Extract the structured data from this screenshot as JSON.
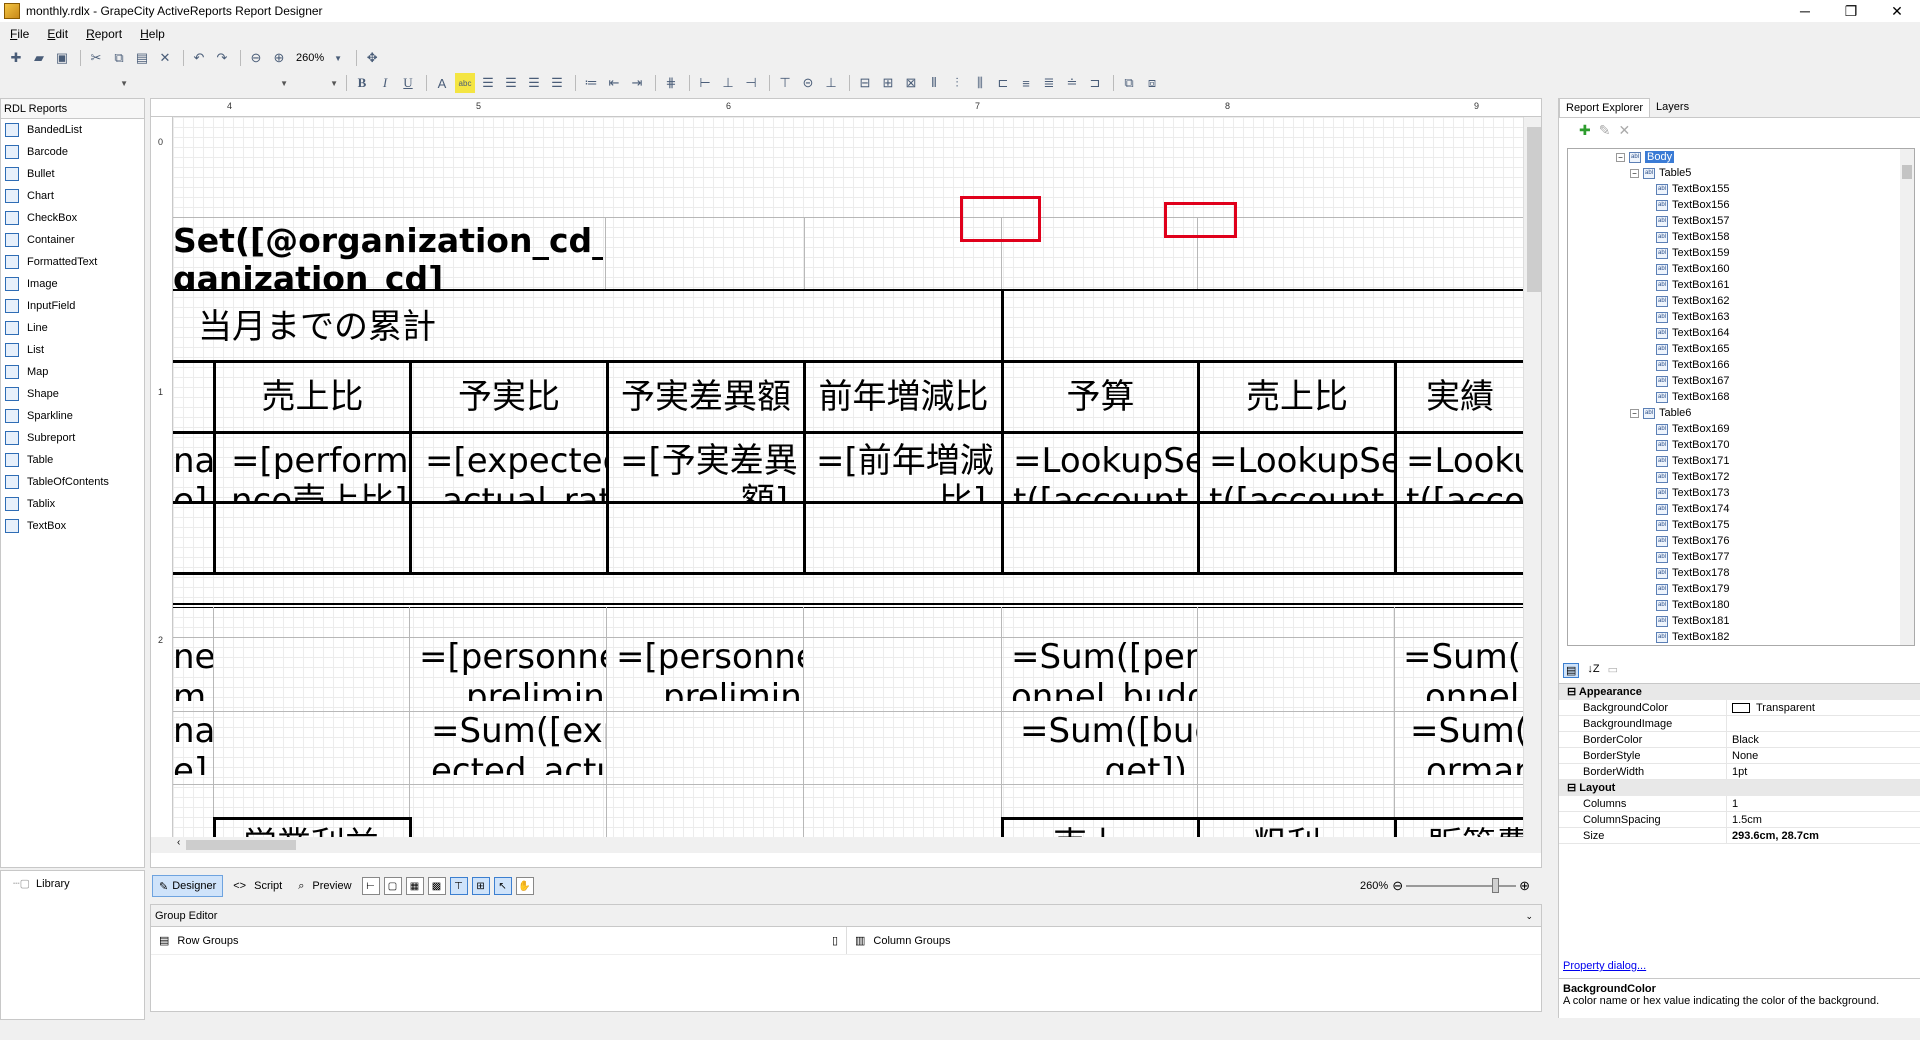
{
  "window": {
    "title": "monthly.rdlx - GrapeCity ActiveReports Report Designer",
    "min": "─",
    "max": "❐",
    "close": "✕"
  },
  "menu": [
    "File",
    "Edit",
    "Report",
    "Help"
  ],
  "toolbar": {
    "zoom": "260%"
  },
  "toolbox": {
    "header": "RDL Reports",
    "items": [
      "BandedList",
      "Barcode",
      "Bullet",
      "Chart",
      "CheckBox",
      "Container",
      "FormattedText",
      "Image",
      "InputField",
      "Line",
      "List",
      "Map",
      "Shape",
      "Sparkline",
      "Subreport",
      "Table",
      "TableOfContents",
      "Tablix",
      "TextBox"
    ]
  },
  "library": {
    "label": "Library"
  },
  "ruler": {
    "top": [
      "4",
      "5",
      "6",
      "7",
      "8",
      "9"
    ],
    "left": [
      "0",
      "1",
      "2"
    ]
  },
  "report": {
    "header_text1": "Set([@organization_cd_lo",
    "header_text2": "ganization_cd]",
    "section_title": "当月までの累計",
    "col_headers": [
      "売上比",
      "予実比",
      "予実差異額",
      "前年増減比",
      "予算",
      "売上比",
      "実績"
    ],
    "row1": [
      "na",
      "=[performa",
      "=[expected",
      "=[予実差異",
      "=[前年増減",
      "=LookupSe",
      "=LookupSe",
      "=Lookup"
    ],
    "row1b": [
      "e]",
      "nce売上比]",
      "_actual_rati",
      "額]",
      "比]",
      "t([account",
      "t([account",
      "t([accoun"
    ],
    "row2": [
      "nel",
      "=[personnel",
      "=[personnel",
      "=Sum([pers",
      "=Sum([pe"
    ],
    "row2b": [
      "m",
      "_preliminar",
      "_preliminar",
      "onnel_budg",
      "onnel_a"
    ],
    "row3": [
      "na",
      "=Sum([exp",
      "=Sum([bud",
      "=Sum([p"
    ],
    "row3b": [
      "e]",
      "ected_actu",
      "get])",
      "ormance"
    ],
    "row4": [
      "営業利益",
      "売上",
      "粗利",
      "販管費"
    ]
  },
  "designer_bar": {
    "designer": "Designer",
    "script": "Script",
    "preview": "Preview",
    "zoom": "260%"
  },
  "group_editor": {
    "title": "Group Editor",
    "row_groups": "Row Groups",
    "column_groups": "Column Groups"
  },
  "right_panel": {
    "tabs": [
      "Report Explorer",
      "Layers"
    ],
    "tree": {
      "body": "Body",
      "table5": "Table5",
      "table5_items": [
        "TextBox155",
        "TextBox156",
        "TextBox157",
        "TextBox158",
        "TextBox159",
        "TextBox160",
        "TextBox161",
        "TextBox162",
        "TextBox163",
        "TextBox164",
        "TextBox165",
        "TextBox166",
        "TextBox167",
        "TextBox168"
      ],
      "table6": "Table6",
      "table6_items": [
        "TextBox169",
        "TextBox170",
        "TextBox171",
        "TextBox172",
        "TextBox173",
        "TextBox174",
        "TextBox175",
        "TextBox176",
        "TextBox177",
        "TextBox178",
        "TextBox179",
        "TextBox180",
        "TextBox181",
        "TextBox182"
      ]
    },
    "properties": {
      "cat_appearance": "Appearance",
      "appearance": [
        {
          "name": "BackgroundColor",
          "value": "Transparent"
        },
        {
          "name": "BackgroundImage",
          "value": ""
        },
        {
          "name": "BorderColor",
          "value": "Black"
        },
        {
          "name": "BorderStyle",
          "value": "None"
        },
        {
          "name": "BorderWidth",
          "value": "1pt"
        }
      ],
      "cat_layout": "Layout",
      "layout": [
        {
          "name": "Columns",
          "value": "1"
        },
        {
          "name": "ColumnSpacing",
          "value": "1.5cm"
        },
        {
          "name": "Size",
          "value": "293.6cm, 28.7cm"
        }
      ]
    },
    "property_dialog": "Property dialog...",
    "help_title": "BackgroundColor",
    "help_text": "A color name or hex value indicating the color of the background."
  }
}
